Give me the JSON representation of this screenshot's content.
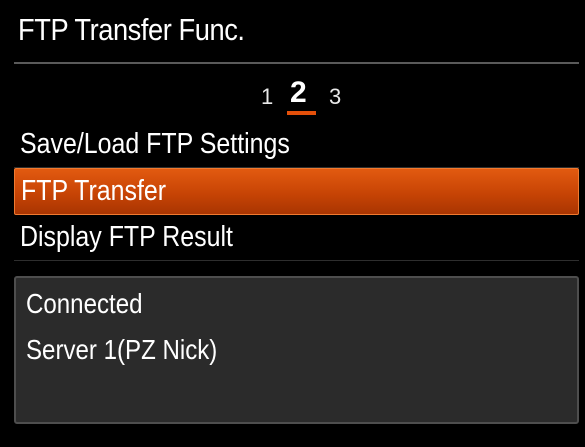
{
  "header": {
    "title": "FTP Transfer Func."
  },
  "pager": {
    "pages": [
      "1",
      "2",
      "3"
    ],
    "current": "2"
  },
  "menu": {
    "items": [
      {
        "label": "Save/Load FTP Settings",
        "selected": false
      },
      {
        "label": "FTP Transfer",
        "selected": true
      },
      {
        "label": "Display FTP Result",
        "selected": false
      }
    ]
  },
  "info": {
    "status": "Connected",
    "server": "Server 1(PZ Nick)"
  },
  "colors": {
    "accent": "#d9500a",
    "background": "#000000",
    "info_box": "#2b2b2b",
    "text": "#ffffff"
  }
}
